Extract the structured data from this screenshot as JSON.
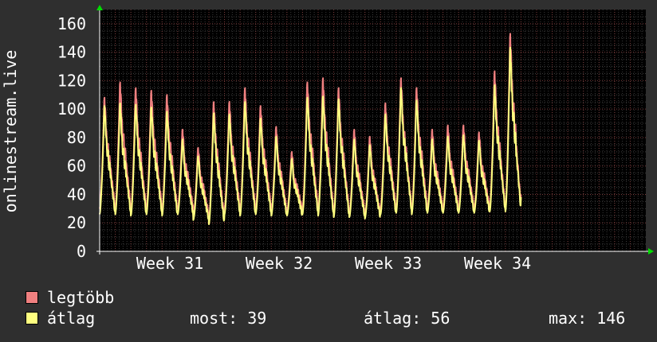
{
  "colors": {
    "background": "#2f2f2f",
    "plot_background": "#000000",
    "grid_major": "#7a3b3b",
    "grid_minor": "#3a3a3a",
    "legtobb": "#f08080",
    "atlag": "#ffff80",
    "arrow": "#00dd00"
  },
  "legend": {
    "items": [
      {
        "label": "legtöbb",
        "color": "#f08080"
      },
      {
        "label": "átlag",
        "color": "#ffff80"
      }
    ],
    "stats": {
      "most": "most: 39",
      "atlag": "átlag: 56",
      "max": "max: 146"
    }
  },
  "chart_data": {
    "type": "line",
    "title": "",
    "xlabel": "",
    "ylabel": "onlinestream.live",
    "ylim": [
      0,
      170
    ],
    "yticks": [
      0,
      20,
      40,
      60,
      80,
      100,
      120,
      140,
      160
    ],
    "week_labels": [
      "Week 31",
      "Week 32",
      "Week 33",
      "Week 34"
    ],
    "x_unit": "days",
    "xlim": [
      0,
      35
    ],
    "week_starts": [
      1,
      8,
      15,
      22
    ],
    "daily_peaks": {
      "legtobb": [
        110,
        121,
        117,
        115,
        112,
        87,
        74,
        107,
        107,
        117,
        104,
        89,
        71,
        121,
        124,
        117,
        87,
        82,
        106,
        124,
        117,
        87,
        90,
        90,
        85,
        129,
        156
      ],
      "atlag": [
        104,
        106,
        105,
        103,
        100,
        80,
        68,
        99,
        98,
        107,
        95,
        82,
        66,
        110,
        111,
        109,
        80,
        76,
        98,
        117,
        108,
        80,
        82,
        83,
        79,
        119,
        146
      ]
    },
    "daily_lows": {
      "legtobb": [
        30,
        30,
        28,
        30,
        28,
        30,
        25,
        22,
        30,
        28,
        30,
        28,
        28,
        30,
        28,
        27,
        27,
        25,
        30,
        29,
        30,
        30,
        30,
        30,
        30,
        30,
        30
      ],
      "atlag": [
        26,
        26,
        25,
        26,
        25,
        26,
        22,
        19,
        26,
        25,
        26,
        25,
        25,
        26,
        25,
        24,
        24,
        23,
        26,
        27,
        26,
        27,
        27,
        27,
        27,
        28,
        28
      ]
    },
    "series": [
      {
        "name": "legtöbb",
        "color": "#f08080"
      },
      {
        "name": "átlag",
        "color": "#ffff80"
      }
    ],
    "grid": true
  }
}
